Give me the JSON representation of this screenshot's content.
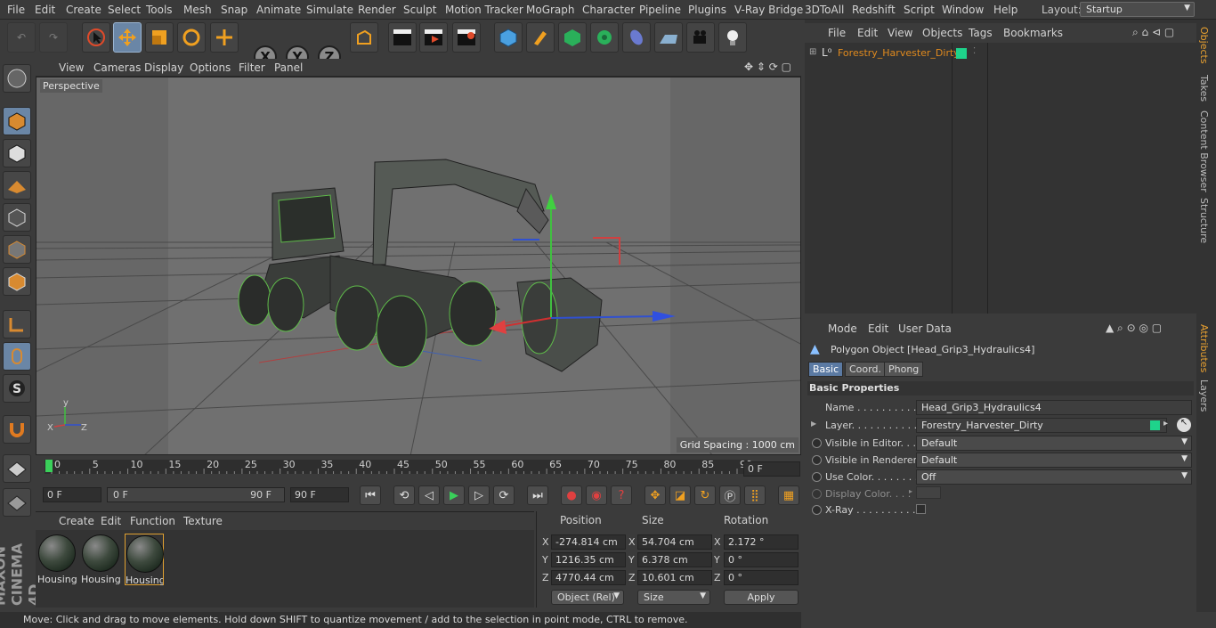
{
  "menu": [
    "File",
    "Edit",
    "Create",
    "Select",
    "Tools",
    "Mesh",
    "Snap",
    "Animate",
    "Simulate",
    "Render",
    "Sculpt",
    "Motion Tracker",
    "MoGraph",
    "Character",
    "Pipeline",
    "Plugins",
    "V-Ray Bridge",
    "3DToAll",
    "Redshift",
    "Script",
    "Window",
    "Help"
  ],
  "layout": {
    "label": "Layout:",
    "value": "Startup"
  },
  "toolbar_axes": [
    "X",
    "Y",
    "Z"
  ],
  "viewport": {
    "menu": [
      "View",
      "Cameras",
      "Display",
      "Options",
      "Filter",
      "Panel"
    ],
    "label": "Perspective",
    "grid_spacing": "Grid Spacing : 1000 cm"
  },
  "timeline": {
    "ticks": [
      "0",
      "5",
      "10",
      "15",
      "20",
      "25",
      "30",
      "35",
      "40",
      "45",
      "50",
      "55",
      "60",
      "65",
      "70",
      "75",
      "80",
      "85",
      "90"
    ],
    "current_frame": "0 F",
    "start": "0 F",
    "range_start": "0 F",
    "range_end": "90 F",
    "end": "90 F"
  },
  "materials": {
    "menu": [
      "Create",
      "Edit",
      "Function",
      "Texture"
    ],
    "items": [
      "Housing",
      "Housing",
      "Housing"
    ]
  },
  "coords": {
    "headers": [
      "Position",
      "Size",
      "Rotation"
    ],
    "position": {
      "x": "-274.814 cm",
      "y": "1216.35 cm",
      "z": "4770.44 cm"
    },
    "size": {
      "x": "54.704 cm",
      "y": "6.378 cm",
      "z": "10.601 cm"
    },
    "rotation": {
      "x": "2.172 °",
      "y": "0 °",
      "z": "0 °"
    },
    "mode": "Object (Rel)",
    "size_mode": "Size",
    "apply": "Apply"
  },
  "status": "Move: Click and drag to move elements. Hold down SHIFT to quantize movement / add to the selection in point mode, CTRL to remove.",
  "objects": {
    "menu": [
      "File",
      "Edit",
      "View",
      "Objects",
      "Tags",
      "Bookmarks"
    ],
    "item": "Forestry_Harvester_Dirty"
  },
  "attributes": {
    "menu": [
      "Mode",
      "Edit",
      "User Data"
    ],
    "title": "Polygon Object [Head_Grip3_Hydraulics4]",
    "tabs": [
      "Basic",
      "Coord.",
      "Phong"
    ],
    "section": "Basic Properties",
    "rows": [
      {
        "label": "Name . . . . . . . . . . . .",
        "value": "Head_Grip3_Hydraulics4"
      },
      {
        "label": "Layer. . . . . . . . . . . .",
        "value": "Forestry_Harvester_Dirty"
      },
      {
        "label": "Visible in Editor. . .",
        "value": "Default"
      },
      {
        "label": "Visible in Renderer",
        "value": "Default"
      },
      {
        "label": "Use Color. . . . . . . .",
        "value": "Off"
      },
      {
        "label": "Display Color. . . .",
        "value": ""
      },
      {
        "label": "X-Ray . . . . . . . . . .",
        "value": ""
      }
    ]
  },
  "side_tabs": [
    "Objects",
    "Takes",
    "Content Browser",
    "Structure",
    "Attributes",
    "Layers"
  ],
  "colors": {
    "accent": "#5b7aa3",
    "object_name": "#e08a1e",
    "layer_swatch": "#1ed38b"
  }
}
